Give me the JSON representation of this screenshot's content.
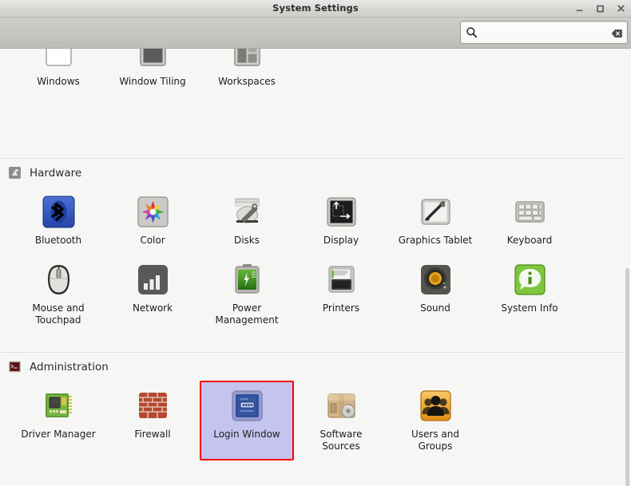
{
  "window": {
    "title": "System Settings",
    "controls": [
      {
        "name": "minimize",
        "glyph": "minimize-icon"
      },
      {
        "name": "maximize",
        "glyph": "maximize-icon"
      },
      {
        "name": "close",
        "glyph": "close-icon"
      }
    ]
  },
  "search": {
    "value": "",
    "placeholder": "",
    "icon": "search-icon",
    "clear_icon": "clear-icon"
  },
  "colors": {
    "selection_background": "#c4c4ee",
    "selection_border": "#ff0000",
    "window_background": "#f6f6f5",
    "titlebar": "#d6d5d2",
    "toolbar": "#c6c5c2"
  },
  "partial_row": {
    "items": [
      {
        "label": "Windows",
        "icon": "windows-icon"
      },
      {
        "label": "Window Tiling",
        "icon": "window-tiling-icon"
      },
      {
        "label": "Workspaces",
        "icon": "workspaces-icon"
      }
    ]
  },
  "sections": [
    {
      "id": "hardware",
      "title": "Hardware",
      "icon": "hardware-icon",
      "items": [
        {
          "label": "Bluetooth",
          "icon": "bluetooth-icon",
          "selected": false
        },
        {
          "label": "Color",
          "icon": "color-icon",
          "selected": false
        },
        {
          "label": "Disks",
          "icon": "disks-icon",
          "selected": false
        },
        {
          "label": "Display",
          "icon": "display-icon",
          "selected": false
        },
        {
          "label": "Graphics Tablet",
          "icon": "graphics-tablet-icon",
          "selected": false
        },
        {
          "label": "Keyboard",
          "icon": "keyboard-icon",
          "selected": false
        },
        {
          "label": "Mouse and\nTouchpad",
          "icon": "mouse-touchpad-icon",
          "selected": false
        },
        {
          "label": "Network",
          "icon": "network-icon",
          "selected": false
        },
        {
          "label": "Power\nManagement",
          "icon": "power-management-icon",
          "selected": false
        },
        {
          "label": "Printers",
          "icon": "printers-icon",
          "selected": false
        },
        {
          "label": "Sound",
          "icon": "sound-icon",
          "selected": false
        },
        {
          "label": "System Info",
          "icon": "system-info-icon",
          "selected": false
        }
      ]
    },
    {
      "id": "administration",
      "title": "Administration",
      "icon": "administration-icon",
      "items": [
        {
          "label": "Driver Manager",
          "icon": "driver-manager-icon",
          "selected": false
        },
        {
          "label": "Firewall",
          "icon": "firewall-icon",
          "selected": false
        },
        {
          "label": "Login Window",
          "icon": "login-window-icon",
          "selected": true
        },
        {
          "label": "Software\nSources",
          "icon": "software-sources-icon",
          "selected": false
        },
        {
          "label": "Users and\nGroups",
          "icon": "users-groups-icon",
          "selected": false
        }
      ]
    }
  ]
}
